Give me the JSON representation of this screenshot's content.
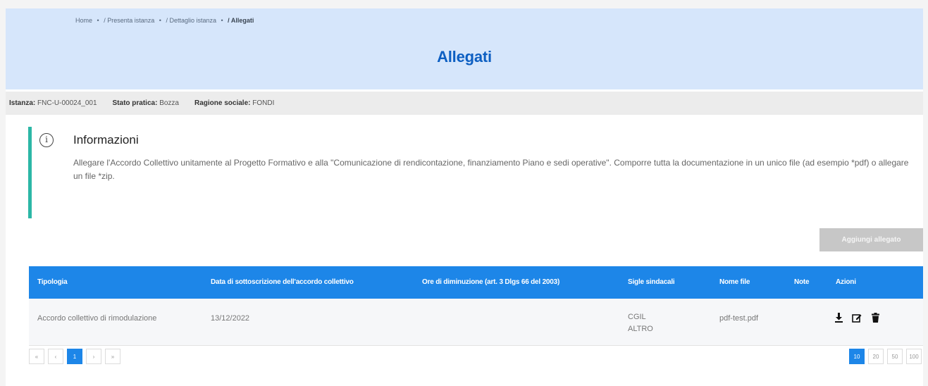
{
  "breadcrumb": {
    "items": [
      "Home",
      "/ Presenta istanza",
      "/ Dettaglio istanza",
      "/ Allegati"
    ],
    "separator": "•"
  },
  "page": {
    "title": "Allegati"
  },
  "infobar": {
    "istanza_label": "Istanza:",
    "istanza_value": "FNC-U-00024_001",
    "stato_label": "Stato pratica:",
    "stato_value": "Bozza",
    "ragione_label": "Ragione sociale:",
    "ragione_value": "FONDI"
  },
  "callout": {
    "icon": "info-icon",
    "title": "Informazioni",
    "text": "Allegare l'Accordo Collettivo unitamente al Progetto Formativo e alla \"Comunicazione di rendicontazione, finanziamento Piano e sedi operative\". Comporre tutta la documentazione in un unico file (ad esempio *pdf) o allegare un file *zip."
  },
  "toolbar": {
    "add_label": "Aggiungi allegato"
  },
  "table": {
    "headers": {
      "tipologia": "Tipologia",
      "data": "Data di sottoscrizione dell'accordo collettivo",
      "ore": "Ore di diminuzione (art. 3 Dlgs 66 del 2003)",
      "sigle": "Sigle sindacali",
      "nome_file": "Nome file",
      "note": "Note",
      "azioni": "Azioni"
    },
    "rows": [
      {
        "tipologia": "Accordo collettivo di rimodulazione",
        "data": "13/12/2022",
        "ore": "",
        "sigle": [
          "CGIL",
          "ALTRO"
        ],
        "nome_file": "pdf-test.pdf",
        "note": "",
        "actions": [
          "download-icon",
          "edit-icon",
          "trash-icon"
        ]
      }
    ]
  },
  "pagination": {
    "controls": [
      "«",
      "‹",
      "1",
      "›",
      "»"
    ],
    "current_page": "1",
    "page_sizes": [
      "10",
      "20",
      "50",
      "100"
    ],
    "selected_size": "10"
  },
  "colors": {
    "header_bg": "#d6e6fb",
    "title": "#0d5fc2",
    "table_header": "#1d86e8",
    "callout_accent": "#2cb7a6",
    "button_disabled": "#c7c7c7"
  }
}
